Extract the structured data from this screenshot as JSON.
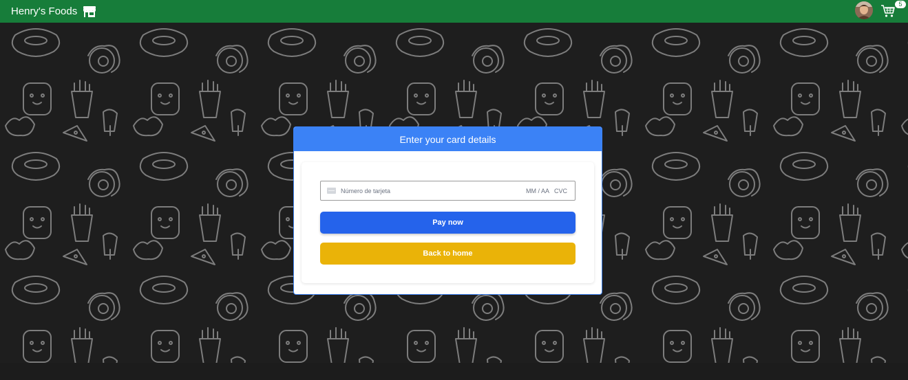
{
  "nav": {
    "brand": "Henry's Foods",
    "cart_count": "5"
  },
  "payment": {
    "title": "Enter your card details",
    "card_number_placeholder": "Número de tarjeta",
    "expiry_placeholder": "MM / AA",
    "cvc_placeholder": "CVC",
    "pay_label": "Pay now",
    "back_label": "Back to home"
  },
  "colors": {
    "navbar": "#177d3a",
    "modal_header": "#3b82f6",
    "pay_button": "#2563eb",
    "back_button": "#eab308",
    "background": "#1e1e1e"
  },
  "icons": {
    "store": "store-icon",
    "cart": "cart-icon",
    "card": "credit-card-icon"
  }
}
